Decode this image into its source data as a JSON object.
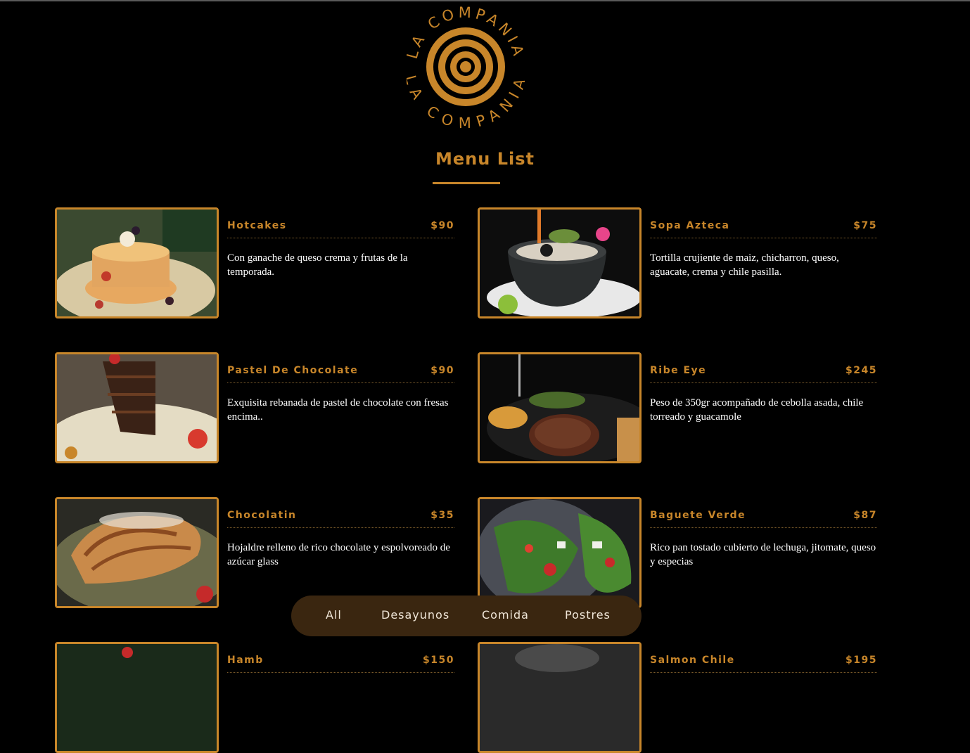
{
  "logo": {
    "text": "LA COMPANIA",
    "color": "#c8862a"
  },
  "section": {
    "title": "Menu List"
  },
  "items": [
    {
      "name": "Hotcakes",
      "price": "$90",
      "desc": "Con ganache de queso crema y frutas de la temporada."
    },
    {
      "name": "Sopa Azteca",
      "price": "$75",
      "desc": "Tortilla crujiente de maiz, chicharron, queso, aguacate, crema y chile pasilla."
    },
    {
      "name": "Pastel De Chocolate",
      "price": "$90",
      "desc": "Exquisita rebanada de pastel de chocolate con fresas encima.."
    },
    {
      "name": "Ribe Eye",
      "price": "$245",
      "desc": "Peso de 350gr acompañado de cebolla asada, chile torreado y guacamole"
    },
    {
      "name": "Chocolatin",
      "price": "$35",
      "desc": "Hojaldre relleno de rico chocolate y espolvoreado de azúcar glass"
    },
    {
      "name": "Baguete Verde",
      "price": "$87",
      "desc": "Rico pan tostado cubierto de lechuga, jitomate, queso y especias"
    },
    {
      "name": "Hamb",
      "price": "$150",
      "desc": ""
    },
    {
      "name": "Salmon Chile",
      "price": "$195",
      "desc": ""
    }
  ],
  "filters": [
    "All",
    "Desayunos",
    "Comida",
    "Postres"
  ],
  "colors": {
    "accent": "#c8862a",
    "background": "#000000",
    "filter_bg": "#3a2610"
  }
}
